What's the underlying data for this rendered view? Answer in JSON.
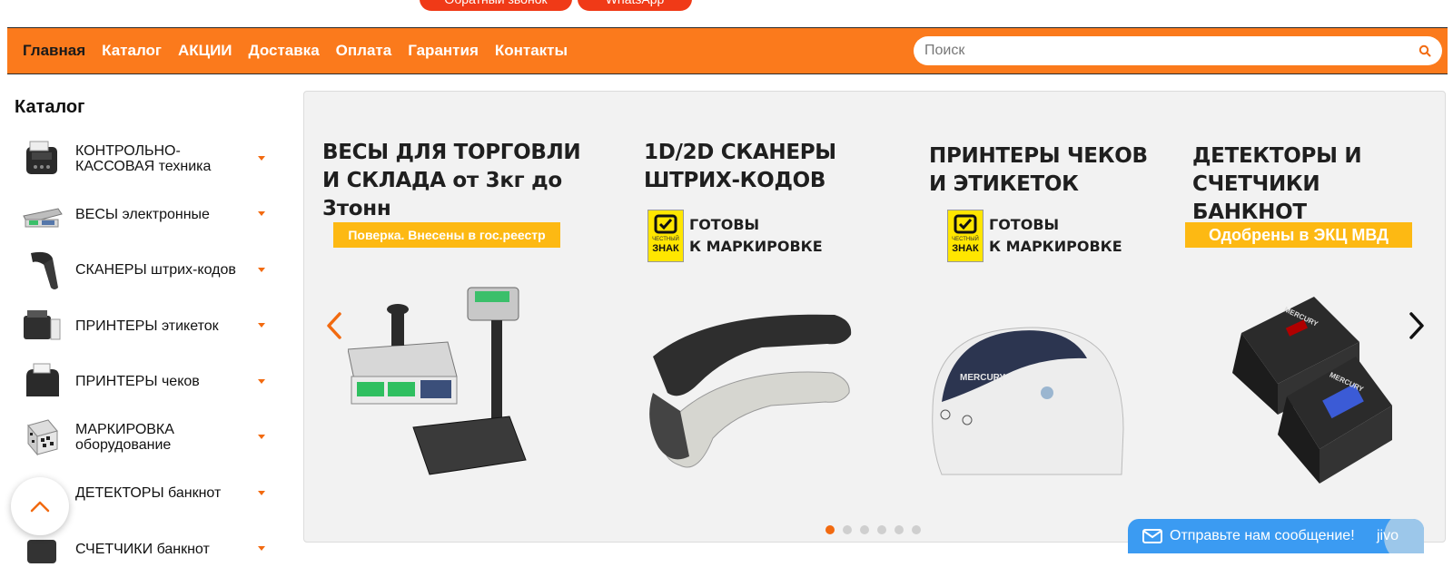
{
  "top": {
    "callback_label": "Обратный звонок",
    "whatsapp_label": "WhatsApp"
  },
  "nav": {
    "items": [
      {
        "label": "Главная",
        "active": true
      },
      {
        "label": "Каталог"
      },
      {
        "label": "АКЦИИ"
      },
      {
        "label": "Доставка"
      },
      {
        "label": "Оплата"
      },
      {
        "label": "Гарантия"
      },
      {
        "label": "Контакты"
      }
    ],
    "search_placeholder": "Поиск"
  },
  "sidebar": {
    "title": "Каталог",
    "items": [
      {
        "label": "КОНТРОЛЬНО-КАССОВАЯ техника",
        "icon": "cash-register-icon"
      },
      {
        "label": "ВЕСЫ электронные",
        "icon": "scales-icon"
      },
      {
        "label": "СКАНЕРЫ штрих-кодов",
        "icon": "barcode-scanner-icon"
      },
      {
        "label": "ПРИНТЕРЫ этикеток",
        "icon": "label-printer-icon"
      },
      {
        "label": "ПРИНТЕРЫ чеков",
        "icon": "receipt-printer-icon"
      },
      {
        "label": "МАРКИРОВКА оборудование",
        "icon": "datamatrix-icon"
      },
      {
        "label": "ДЕТЕКТОРЫ банкнот",
        "icon": "banknote-detector-icon"
      },
      {
        "label": "СЧЕТЧИКИ банкнот",
        "icon": "banknote-counter-icon"
      }
    ]
  },
  "slider": {
    "slides": [
      {
        "title": "ВЕСЫ ДЛЯ ТОРГОВЛИ\nИ СКЛАДА от 3кг до 3тонн",
        "badge": "Поверка. Внесены в гос.реестр"
      },
      {
        "title": "1D/2D СКАНЕРЫ\nШТРИХ-КОДОВ",
        "mark_text": "ГОТОВЫ\nК МАРКИРОВКЕ",
        "mark_logo_small": "ЧЕСТНЫЙ",
        "mark_logo_word": "ЗНАК"
      },
      {
        "title": "ПРИНТЕРЫ ЧЕКОВ\nИ ЭТИКЕТОК",
        "mark_text": "ГОТОВЫ\nК МАРКИРОВКЕ",
        "mark_logo_small": "ЧЕСТНЫЙ",
        "mark_logo_word": "ЗНАК",
        "brand": "MERCURY"
      },
      {
        "title": "ДЕТЕКТОРЫ И\nСЧЕТЧИКИ БАНКНОТ",
        "badge": "Одобрены в ЭКЦ МВД",
        "brand": "MERCURY"
      }
    ],
    "dots_count": 6,
    "active_dot": 0
  },
  "jivo": {
    "message": "Отправьте нам сообщение!",
    "brand": "jivo"
  },
  "colors": {
    "accent": "#fb7a1c",
    "pill_red": "#f03a17",
    "badge_yellow": "#fdb913",
    "jivo_blue": "#3b9bf2"
  }
}
